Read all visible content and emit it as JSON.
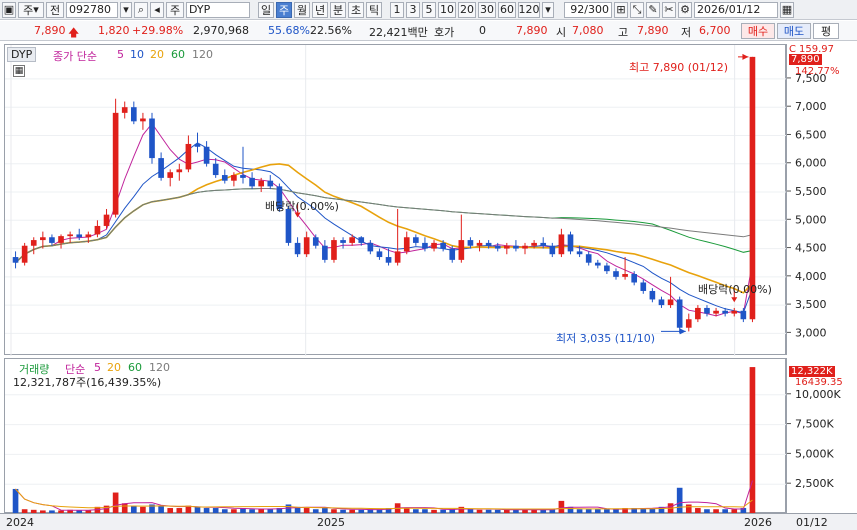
{
  "toolbar": {
    "market": "주",
    "prefix": "전",
    "code": "092780",
    "type_label": "주",
    "name": "DYP",
    "periods": [
      "일",
      "주",
      "월",
      "년",
      "분",
      "초",
      "틱"
    ],
    "selected_period": "주",
    "nums": [
      "1",
      "3",
      "5",
      "10",
      "20",
      "30",
      "60",
      "120"
    ],
    "count": "92/300",
    "date": "2026/01/12"
  },
  "quote": {
    "price": "7,890",
    "change": "1,820",
    "change_pct": "+29.98%",
    "volume": "2,970,968",
    "ratio": "55.68%",
    "turnover": "22.56%",
    "amount": "22,421백만",
    "hoga_label": "호가",
    "hoga_value": "0",
    "current": "7,890",
    "open_label": "시",
    "open": "7,080",
    "high_label": "고",
    "high": "7,890",
    "low_label": "저",
    "low": "6,700",
    "buy": "매수",
    "sell": "매도",
    "eval": "평"
  },
  "price_panel": {
    "name": "DYP",
    "legend_label": "종가 단순",
    "ma": [
      "5",
      "10",
      "20",
      "60",
      "120"
    ],
    "ma_colors": [
      "#c0239b",
      "#1f55c7",
      "#e8a20c",
      "#1a9a3a",
      "#7b7b7b"
    ],
    "high_annot": "최고 7,890 (01/12)",
    "low_annot": "최저 3,035 (11/10)",
    "div1": "배당락(0.00%)",
    "div2": "배당락(0.00%)",
    "right_top": "159.97",
    "right_price": "7,890",
    "right_pct": "142.77%",
    "right_top_prefix": "C"
  },
  "volume_panel": {
    "label": "거래량",
    "legend_label": "단순",
    "ma": [
      "5",
      "20",
      "60",
      "120"
    ],
    "ma_colors": [
      "#c0239b",
      "#e8a20c",
      "#1a9a3a",
      "#7b7b7b"
    ],
    "total": "12,321,787주(16,439.35%)",
    "right_vol": "12,322K",
    "right_pct": "16439.35"
  },
  "dates": [
    "2024",
    "2025",
    "2026",
    "01/12"
  ],
  "colors": {
    "up": "#e0201b",
    "down": "#1f55c7",
    "accent": "#4a7fd1"
  },
  "chart_data": [
    {
      "type": "candlestick",
      "title": "DYP",
      "x": "weekly",
      "ylim": [
        2600,
        8100
      ],
      "y_ticks": [
        3000,
        3500,
        4000,
        4500,
        5000,
        5500,
        6000,
        6500,
        7000,
        7500
      ],
      "candles": [
        [
          4350,
          4450,
          4150,
          4250
        ],
        [
          4250,
          4600,
          4200,
          4550
        ],
        [
          4550,
          4700,
          4400,
          4650
        ],
        [
          4650,
          4800,
          4500,
          4700
        ],
        [
          4700,
          4750,
          4550,
          4600
        ],
        [
          4600,
          4750,
          4500,
          4720
        ],
        [
          4720,
          4800,
          4600,
          4750
        ],
        [
          4750,
          4850,
          4650,
          4700
        ],
        [
          4700,
          4800,
          4600,
          4750
        ],
        [
          4750,
          5000,
          4700,
          4900
        ],
        [
          4900,
          5200,
          4850,
          5100
        ],
        [
          5100,
          7150,
          5050,
          6900
        ],
        [
          6900,
          7100,
          6800,
          7000
        ],
        [
          7000,
          7100,
          6700,
          6750
        ],
        [
          6750,
          6900,
          6600,
          6800
        ],
        [
          6800,
          6900,
          6000,
          6100
        ],
        [
          6100,
          6200,
          5700,
          5750
        ],
        [
          5750,
          5900,
          5600,
          5850
        ],
        [
          5850,
          6000,
          5700,
          5900
        ],
        [
          5900,
          6500,
          5850,
          6350
        ],
        [
          6350,
          6550,
          6200,
          6300
        ],
        [
          6300,
          6400,
          5950,
          6000
        ],
        [
          6000,
          6100,
          5750,
          5800
        ],
        [
          5800,
          5900,
          5650,
          5700
        ],
        [
          5700,
          5850,
          5600,
          5800
        ],
        [
          5800,
          6300,
          5650,
          5750
        ],
        [
          5750,
          5850,
          5550,
          5600
        ],
        [
          5600,
          5750,
          5500,
          5700
        ],
        [
          5700,
          5800,
          5550,
          5600
        ],
        [
          5600,
          5650,
          5150,
          5200
        ],
        [
          5200,
          5250,
          4550,
          4600
        ],
        [
          4600,
          4700,
          4350,
          4400
        ],
        [
          4400,
          4800,
          4350,
          4700
        ],
        [
          4700,
          4750,
          4500,
          4550
        ],
        [
          4550,
          4650,
          4250,
          4300
        ],
        [
          4300,
          4700,
          4250,
          4650
        ],
        [
          4650,
          4700,
          4500,
          4600
        ],
        [
          4600,
          4750,
          4550,
          4700
        ],
        [
          4700,
          4720,
          4550,
          4600
        ],
        [
          4600,
          4650,
          4400,
          4450
        ],
        [
          4450,
          4500,
          4300,
          4350
        ],
        [
          4350,
          4500,
          4200,
          4250
        ],
        [
          4250,
          5200,
          4200,
          4450
        ],
        [
          4450,
          4800,
          4400,
          4700
        ],
        [
          4700,
          4750,
          4550,
          4600
        ],
        [
          4600,
          4700,
          4450,
          4500
        ],
        [
          4500,
          4650,
          4450,
          4600
        ],
        [
          4600,
          4650,
          4450,
          4500
        ],
        [
          4500,
          4550,
          4250,
          4300
        ],
        [
          4300,
          5100,
          4250,
          4650
        ],
        [
          4650,
          4700,
          4500,
          4550
        ],
        [
          4550,
          4650,
          4450,
          4600
        ],
        [
          4600,
          4650,
          4500,
          4550
        ],
        [
          4550,
          4600,
          4450,
          4500
        ],
        [
          4500,
          4600,
          4400,
          4550
        ],
        [
          4550,
          4650,
          4450,
          4500
        ],
        [
          4500,
          4600,
          4400,
          4550
        ],
        [
          4550,
          4650,
          4500,
          4600
        ],
        [
          4600,
          4700,
          4500,
          4550
        ],
        [
          4550,
          4600,
          4350,
          4400
        ],
        [
          4400,
          4850,
          4350,
          4750
        ],
        [
          4750,
          4800,
          4400,
          4450
        ],
        [
          4450,
          4550,
          4350,
          4400
        ],
        [
          4400,
          4450,
          4200,
          4250
        ],
        [
          4250,
          4300,
          4150,
          4200
        ],
        [
          4200,
          4250,
          4050,
          4100
        ],
        [
          4100,
          4150,
          3950,
          4000
        ],
        [
          4000,
          4350,
          3950,
          4050
        ],
        [
          4050,
          4100,
          3850,
          3900
        ],
        [
          3900,
          3950,
          3700,
          3750
        ],
        [
          3750,
          3800,
          3550,
          3600
        ],
        [
          3600,
          3650,
          3450,
          3500
        ],
        [
          3500,
          4000,
          3450,
          3600
        ],
        [
          3600,
          3650,
          3000,
          3100
        ],
        [
          3100,
          3350,
          3035,
          3250
        ],
        [
          3250,
          3500,
          3200,
          3450
        ],
        [
          3450,
          3500,
          3300,
          3350
        ],
        [
          3350,
          3450,
          3300,
          3400
        ],
        [
          3400,
          3450,
          3300,
          3350
        ],
        [
          3350,
          3450,
          3300,
          3400
        ],
        [
          3400,
          3450,
          3200,
          3250
        ],
        [
          3250,
          7890,
          3200,
          7890
        ]
      ]
    },
    {
      "type": "bar",
      "title": "거래량",
      "ylim": [
        0,
        13000
      ],
      "y_ticks": [
        2500,
        5000,
        7500,
        10000
      ],
      "values": [
        2100,
        400,
        350,
        300,
        300,
        300,
        350,
        300,
        300,
        600,
        700,
        1800,
        900,
        700,
        600,
        800,
        700,
        500,
        500,
        700,
        600,
        500,
        500,
        400,
        400,
        500,
        400,
        400,
        400,
        500,
        800,
        600,
        500,
        400,
        500,
        400,
        350,
        350,
        350,
        400,
        400,
        500,
        900,
        500,
        400,
        400,
        350,
        350,
        400,
        600,
        400,
        350,
        350,
        350,
        350,
        350,
        350,
        350,
        350,
        400,
        1100,
        600,
        400,
        400,
        400,
        400,
        400,
        500,
        500,
        500,
        500,
        600,
        900,
        2200,
        800,
        500,
        400,
        400,
        400,
        400,
        500,
        12322
      ]
    }
  ]
}
